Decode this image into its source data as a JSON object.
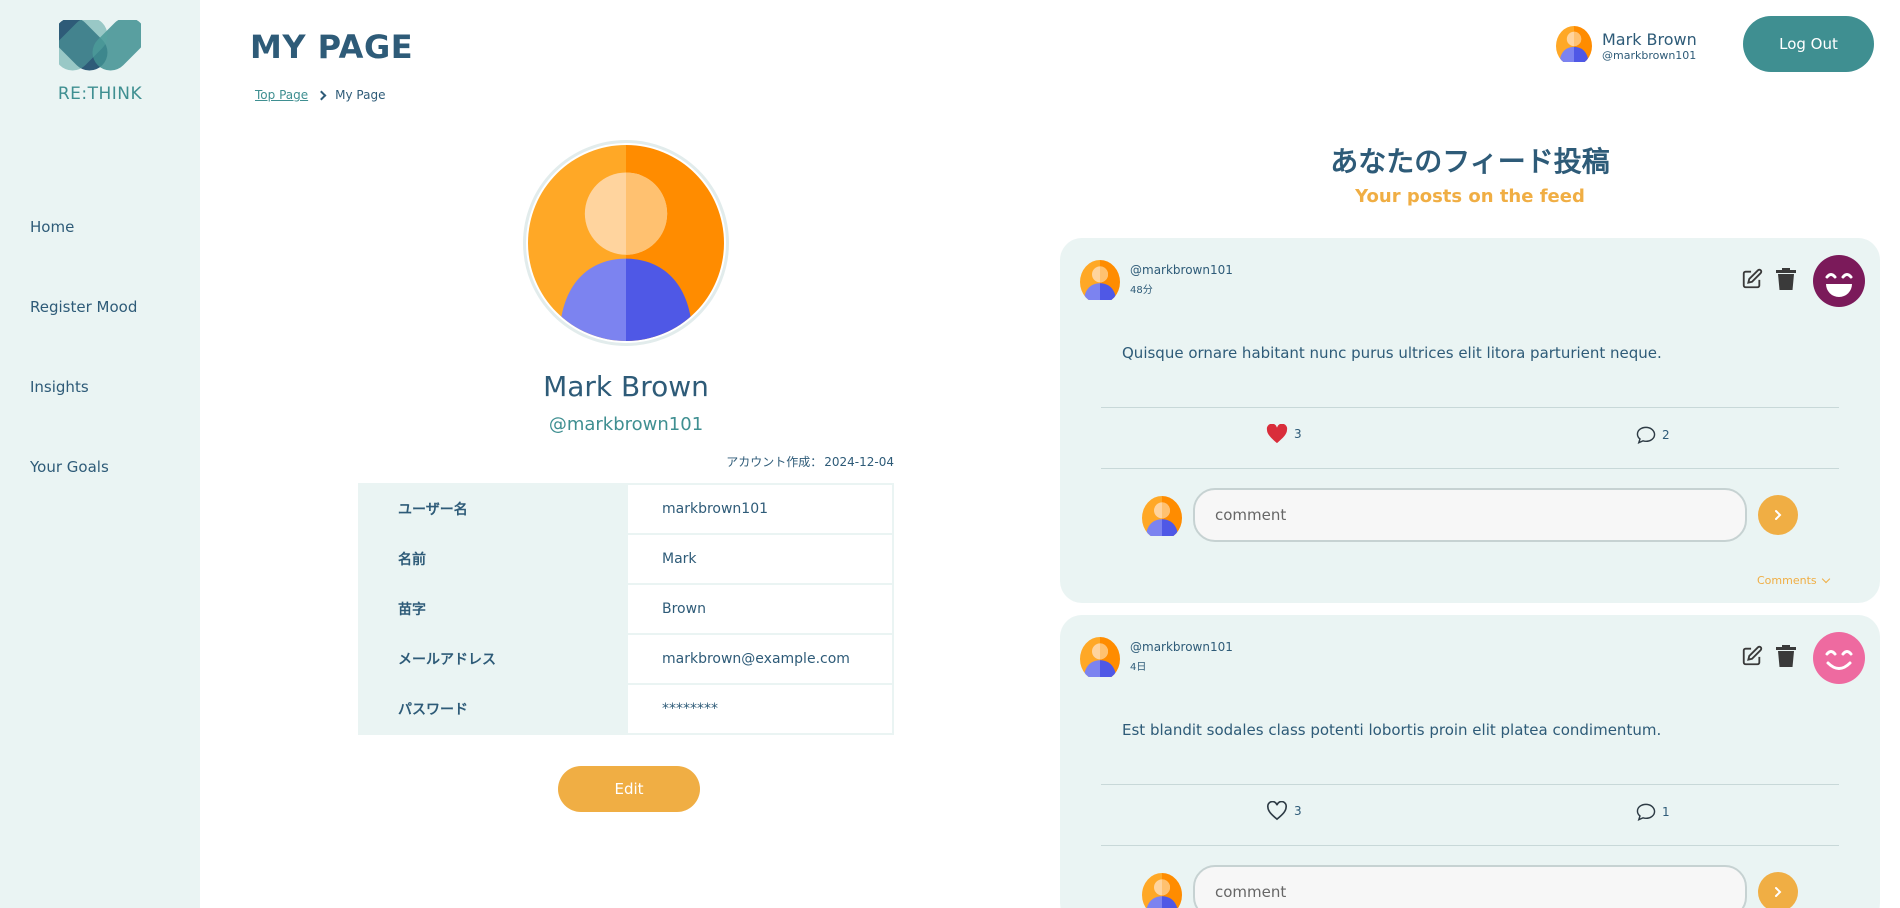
{
  "brand": {
    "name": "RE:THINK"
  },
  "colors": {
    "primary": "#2e5b78",
    "teal": "#3f8f91",
    "accent": "#f0ae44",
    "sidebar_bg": "#eaf4f3"
  },
  "sidebar": {
    "items": [
      {
        "label": "Home"
      },
      {
        "label": "Register Mood"
      },
      {
        "label": "Insights"
      },
      {
        "label": "Your Goals"
      }
    ]
  },
  "header": {
    "title": "MY PAGE",
    "breadcrumb": {
      "link": "Top Page",
      "current": "My Page"
    },
    "user": {
      "name": "Mark Brown",
      "handle": "@markbrown101"
    },
    "logout_label": "Log Out"
  },
  "profile": {
    "name": "Mark Brown",
    "handle": "@markbrown101",
    "created_label": "アカウント作成：",
    "created_date": "2024-12-04",
    "fields": [
      {
        "key": "ユーザー名",
        "value": "markbrown101"
      },
      {
        "key": "名前",
        "value": "Mark"
      },
      {
        "key": "苗字",
        "value": "Brown"
      },
      {
        "key": "メールアドレス",
        "value": "markbrown@example.com"
      },
      {
        "key": "パスワード",
        "value": "********"
      }
    ],
    "edit_label": "Edit"
  },
  "feed": {
    "title_jp": "あなたのフィード投稿",
    "title_en": "Your posts on the feed",
    "posts": [
      {
        "handle": "@markbrown101",
        "time": "48分",
        "body": "Quisque ornare habitant nunc purus ultrices elit litora parturient neque.",
        "likes": "3",
        "liked": true,
        "comments": "2",
        "mood_icon": "big-grin-mood-icon",
        "mood_color": "#7b1a5a",
        "comment_placeholder": "comment",
        "comments_toggle": "Comments"
      },
      {
        "handle": "@markbrown101",
        "time": "4日",
        "body": "Est blandit sodales class potenti lobortis proin elit platea condimentum.",
        "likes": "3",
        "liked": false,
        "comments": "1",
        "mood_icon": "smile-mood-icon",
        "mood_color": "#ee6aa0",
        "comment_placeholder": "comment"
      }
    ]
  }
}
